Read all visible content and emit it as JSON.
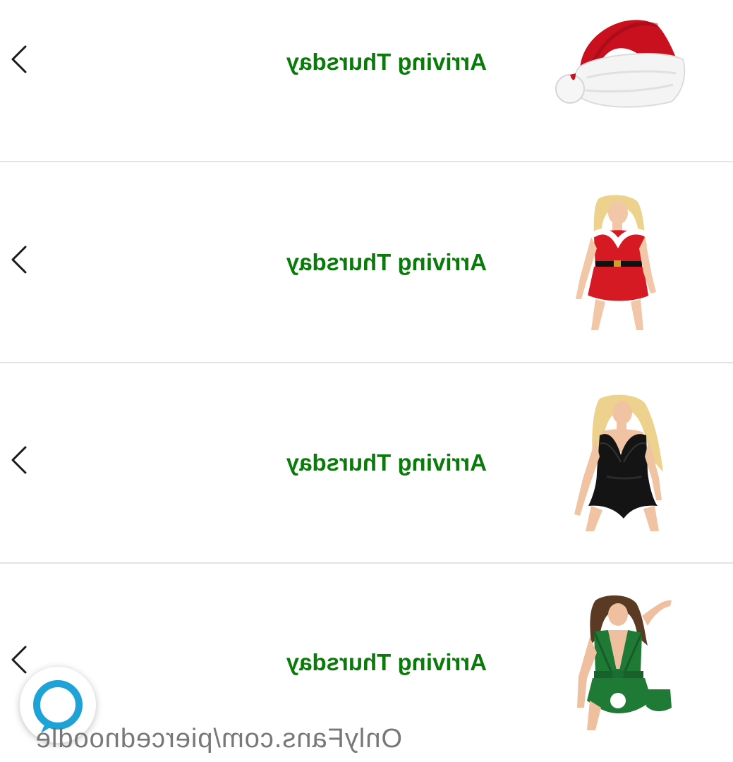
{
  "orders": [
    {
      "status": "Arriving Thursday",
      "item_icon": "santa-hat-image",
      "chevron_icon": "chevron-left-icon"
    },
    {
      "status": "Arriving Thursday",
      "item_icon": "red-lace-bodysuit-image",
      "chevron_icon": "chevron-left-icon"
    },
    {
      "status": "Arriving Thursday",
      "item_icon": "black-lace-bodysuit-image",
      "chevron_icon": "chevron-left-icon"
    },
    {
      "status": "Arriving Thursday",
      "item_icon": "green-lace-bodysuit-image",
      "chevron_icon": "chevron-left-icon"
    }
  ],
  "colors": {
    "status_text": "#0a7a0a",
    "divider": "#e4e4e4",
    "alexa_ring": "#1fa3d6"
  },
  "alexa_button": {
    "icon": "alexa-icon"
  },
  "watermark": {
    "text": "OnlyFans.com/piercednoodle"
  }
}
